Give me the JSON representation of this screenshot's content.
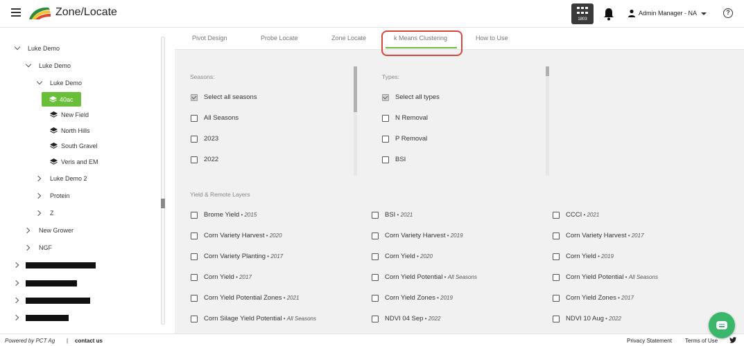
{
  "header": {
    "app_title": "Zone/Locate",
    "apps_badge": "1803",
    "user_name": "Admin Manager - NA"
  },
  "sidebar": {
    "tree": [
      {
        "label": "Luke Demo"
      },
      {
        "label": "Luke Demo"
      },
      {
        "label": "Luke Demo"
      },
      {
        "label": "40ac"
      },
      {
        "label": "New Field"
      },
      {
        "label": "North Hills"
      },
      {
        "label": "South Gravel"
      },
      {
        "label": "Veris and EM"
      },
      {
        "label": "Luke Demo 2"
      },
      {
        "label": "Protein"
      },
      {
        "label": "Z"
      },
      {
        "label": "New Grower"
      },
      {
        "label": "NGF"
      }
    ]
  },
  "tabs": [
    {
      "label": "Pivot Design"
    },
    {
      "label": "Probe Locate"
    },
    {
      "label": "Zone Locate"
    },
    {
      "label": "k Means Clustering"
    },
    {
      "label": "How to Use"
    }
  ],
  "active_tab": "k Means Clustering",
  "seasons": {
    "label": "Seasons:",
    "items": [
      {
        "label": "Select all seasons",
        "checked": true
      },
      {
        "label": "All Seasons",
        "checked": false
      },
      {
        "label": "2023",
        "checked": false
      },
      {
        "label": "2022",
        "checked": false
      }
    ]
  },
  "types": {
    "label": "Types:",
    "items": [
      {
        "label": "Select all types",
        "checked": true
      },
      {
        "label": "N Removal",
        "checked": false
      },
      {
        "label": "P Removal",
        "checked": false
      },
      {
        "label": "BSI",
        "checked": false
      }
    ]
  },
  "layers": {
    "label": "Yield & Remote Layers",
    "columns": [
      [
        {
          "name": "Brome Yield",
          "meta": "2015"
        },
        {
          "name": "Corn Variety Harvest",
          "meta": "2020"
        },
        {
          "name": "Corn Variety Planting",
          "meta": "2017"
        },
        {
          "name": "Corn Yield",
          "meta": "2017"
        },
        {
          "name": "Corn Yield Potential Zones",
          "meta": "2021"
        },
        {
          "name": "Corn Silage Yield Potential",
          "meta": "All Seasons"
        }
      ],
      [
        {
          "name": "BSI",
          "meta": "2021"
        },
        {
          "name": "Corn Variety Harvest",
          "meta": "2019"
        },
        {
          "name": "Corn Yield",
          "meta": "2020"
        },
        {
          "name": "Corn Yield Potential",
          "meta": "All Seasons"
        },
        {
          "name": "Corn Yield Zones",
          "meta": "2019"
        },
        {
          "name": "NDVI 04 Sep",
          "meta": "2022"
        }
      ],
      [
        {
          "name": "CCCI",
          "meta": "2021"
        },
        {
          "name": "Corn Variety Harvest",
          "meta": "2017"
        },
        {
          "name": "Corn Yield",
          "meta": "2019"
        },
        {
          "name": "Corn Yield Potential",
          "meta": "All Seasons"
        },
        {
          "name": "Corn Yield Zones",
          "meta": "2017"
        },
        {
          "name": "NDVI 10 Aug",
          "meta": "2022"
        }
      ]
    ],
    "separator": " • "
  },
  "footer": {
    "powered_by": "Powered by PCT Ag",
    "separator": "|",
    "contact": "contact us",
    "privacy": "Privacy Statement",
    "terms": "Terms of Use"
  },
  "colors": {
    "accent_green": "#6abf3a",
    "highlight_red": "#d9453a",
    "chat_green": "#3ab76a"
  }
}
